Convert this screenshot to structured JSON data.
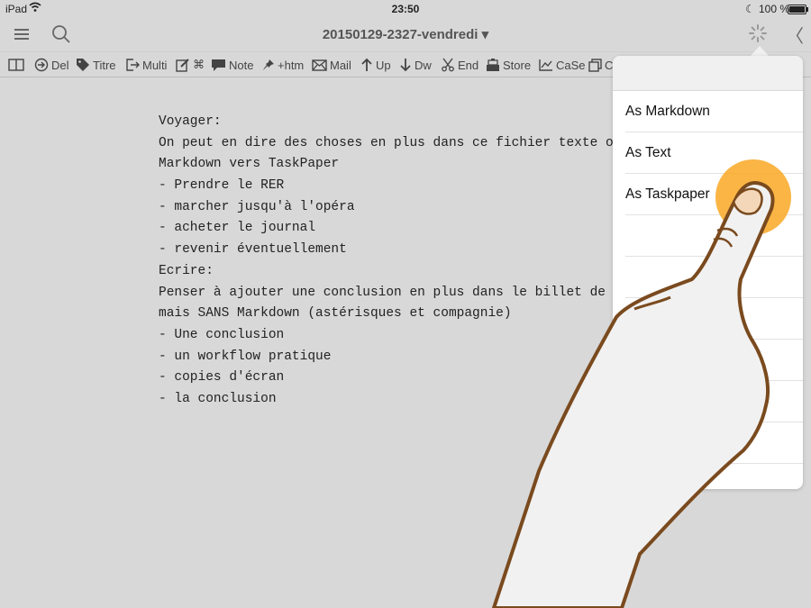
{
  "status": {
    "carrier": "iPad",
    "time": "23:50",
    "battery": "100 %"
  },
  "nav": {
    "title": "20150129-2327-vendredi ▾"
  },
  "toolbar": {
    "items": [
      "Del",
      "Titre",
      "Multi",
      "⌘",
      "Note",
      "+htm",
      "Mail",
      "Up",
      "Dw",
      "End",
      "Store",
      "CaSe",
      "Cl"
    ]
  },
  "editor": {
    "lines": [
      "Voyager:",
      "On peut en dire des choses en plus dans ce fichier texte ou",
      "Markdown vers TaskPaper",
      "- Prendre le RER",
      "- marcher jusqu'à l'opéra",
      "- acheter le journal",
      "- revenir éventuellement",
      "Ecrire:",
      "Penser à ajouter une conclusion en plus dans le billet de dé",
      "mais SANS Markdown (astérisques et compagnie)",
      "- Une conclusion",
      "- un workflow pratique",
      "- copies d'écran",
      "- la conclusion"
    ]
  },
  "popover": {
    "items": [
      "As Markdown",
      "As Text",
      "As Taskpaper",
      "",
      "",
      "",
      "",
      "",
      "",
      ""
    ]
  },
  "colors": {
    "background": "#d8d8d8",
    "touch_highlight": "#f9a825",
    "hand_outline": "#7a4a1e"
  }
}
